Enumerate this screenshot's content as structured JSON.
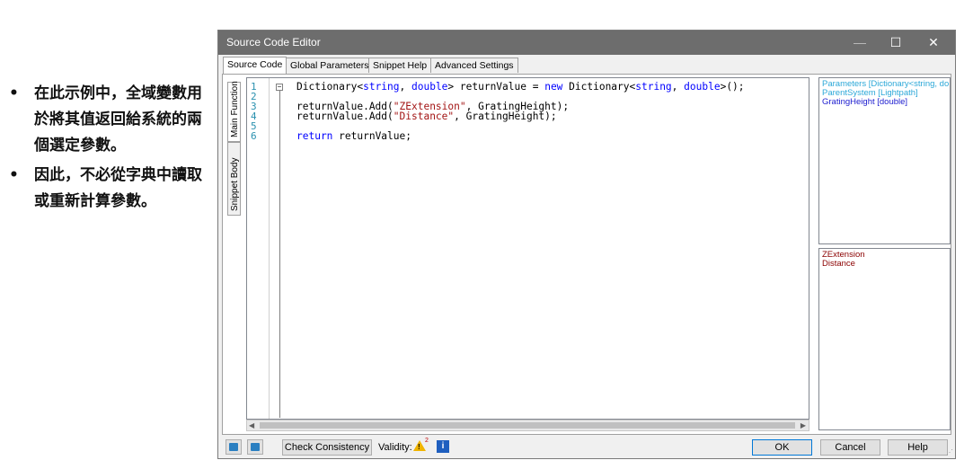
{
  "notes": {
    "items": [
      "在此示例中，全域變數用於將其值返回給系統的兩個選定參數。",
      "因此，不必從字典中讀取或重新計算參數。"
    ]
  },
  "window": {
    "title": "Source Code Editor",
    "controls": {
      "minimize": "—",
      "maximize": "☐",
      "close": "✕"
    }
  },
  "tabs": [
    "Source Code",
    "Global Parameters",
    "Snippet Help",
    "Advanced Settings"
  ],
  "side_tabs": {
    "main_function": "Main Function",
    "snippet_body": "Snippet Body"
  },
  "editor": {
    "line_numbers": [
      "1",
      "2",
      "3",
      "4",
      "5",
      "6"
    ],
    "fold_symbol": "⊟"
  },
  "code_lines": [
    [
      {
        "t": "Dictionary<",
        "c": ""
      },
      {
        "t": "string",
        "c": "kw"
      },
      {
        "t": ", ",
        "c": ""
      },
      {
        "t": "double",
        "c": "kw"
      },
      {
        "t": "> returnValue = ",
        "c": ""
      },
      {
        "t": "new",
        "c": "kw"
      },
      {
        "t": " Dictionary<",
        "c": ""
      },
      {
        "t": "string",
        "c": "kw"
      },
      {
        "t": ", ",
        "c": ""
      },
      {
        "t": "double",
        "c": "kw"
      },
      {
        "t": ">();",
        "c": ""
      }
    ],
    [],
    [
      {
        "t": "returnValue.Add(",
        "c": ""
      },
      {
        "t": "\"ZExtension\"",
        "c": "str"
      },
      {
        "t": ", GratingHeight);",
        "c": ""
      }
    ],
    [
      {
        "t": "returnValue.Add(",
        "c": ""
      },
      {
        "t": "\"Distance\"",
        "c": "str"
      },
      {
        "t": ", GratingHeight);",
        "c": ""
      }
    ],
    [],
    [
      {
        "t": "return",
        "c": "kw"
      },
      {
        "t": " returnValue;",
        "c": ""
      }
    ]
  ],
  "parameters_panel": {
    "items": [
      {
        "text": "Parameters [Dictionary<string, do",
        "color": "#2ca8d8"
      },
      {
        "text": "ParentSystem [Lightpath]",
        "color": "#2ca8d8"
      },
      {
        "text": "GratingHeight [double]",
        "color": "#1c1ccf"
      }
    ]
  },
  "outputs_panel": {
    "items": [
      "ZExtension",
      "Distance"
    ]
  },
  "bottom": {
    "check_consistency": "Check Consistency",
    "validity_label": "Validity:",
    "warning_count": "2",
    "info_label": "i",
    "ok": "OK",
    "cancel": "Cancel",
    "help": "Help"
  }
}
